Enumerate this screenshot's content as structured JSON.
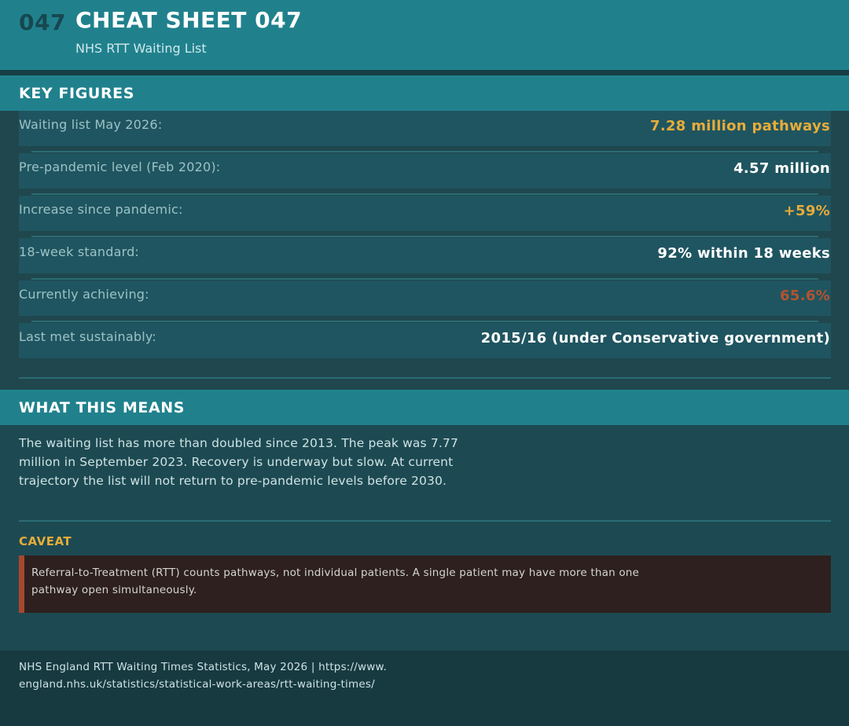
{
  "header": {
    "number": "047",
    "title": "CHEAT SHEET 047",
    "subtitle": "NHS RTT Waiting List"
  },
  "key_figures": {
    "heading": "KEY FIGURES",
    "rows": [
      {
        "label": "Waiting list May 2026:",
        "value": "7.28 million pathways",
        "tone": "gold"
      },
      {
        "label": "Pre-pandemic level (Feb 2020):",
        "value": "4.57 million",
        "tone": "white"
      },
      {
        "label": "Increase since pandemic:",
        "value": "+59%",
        "tone": "gold"
      },
      {
        "label": "18-week standard:",
        "value": "92% within 18 weeks",
        "tone": "white"
      },
      {
        "label": "Currently achieving:",
        "value": "65.6%",
        "tone": "rust"
      },
      {
        "label": "Last met sustainably:",
        "value": "2015/16 (under Conservative government)",
        "tone": "white"
      }
    ]
  },
  "what_this_means": {
    "heading": "WHAT THIS MEANS",
    "text": "The waiting list has more than doubled since 2013. The peak was 7.77 million in September 2023. Recovery is underway but slow. At current trajectory the list will not return to pre-pandemic levels before 2030."
  },
  "caveat": {
    "heading": "CAVEAT",
    "text": "Referral-to-Treatment (RTT) counts pathways, not individual patients. A single patient may have more than one pathway open simultaneously."
  },
  "footer": {
    "source": "NHS England RTT Waiting Times Statistics, May 2026 | https://www.england.nhs.uk/statistics/statistical-work-areas/rtt-waiting-times/"
  },
  "colors": {
    "accent_teal": "#20818d",
    "highlight_gold": "#e8ac3a",
    "warning_rust": "#b4532f",
    "background": "#1d4a52"
  }
}
